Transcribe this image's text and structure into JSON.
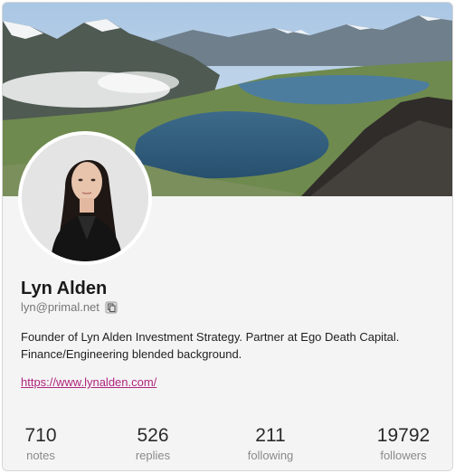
{
  "profile": {
    "name": "Lyn Alden",
    "handle": "lyn@primal.net",
    "bio": "Founder of Lyn Alden Investment Strategy. Partner at Ego Death Capital. Finance/Engineering blended background.",
    "website": "https://www.lynalden.com/"
  },
  "stats": {
    "notes": {
      "value": "710",
      "label": "notes"
    },
    "replies": {
      "value": "526",
      "label": "replies"
    },
    "following": {
      "value": "211",
      "label": "following"
    },
    "followers": {
      "value": "19792",
      "label": "followers"
    }
  },
  "colors": {
    "accent_link": "#b0257e",
    "card_background": "#f4f4f4"
  },
  "icons": {
    "copy": "copy-icon"
  }
}
